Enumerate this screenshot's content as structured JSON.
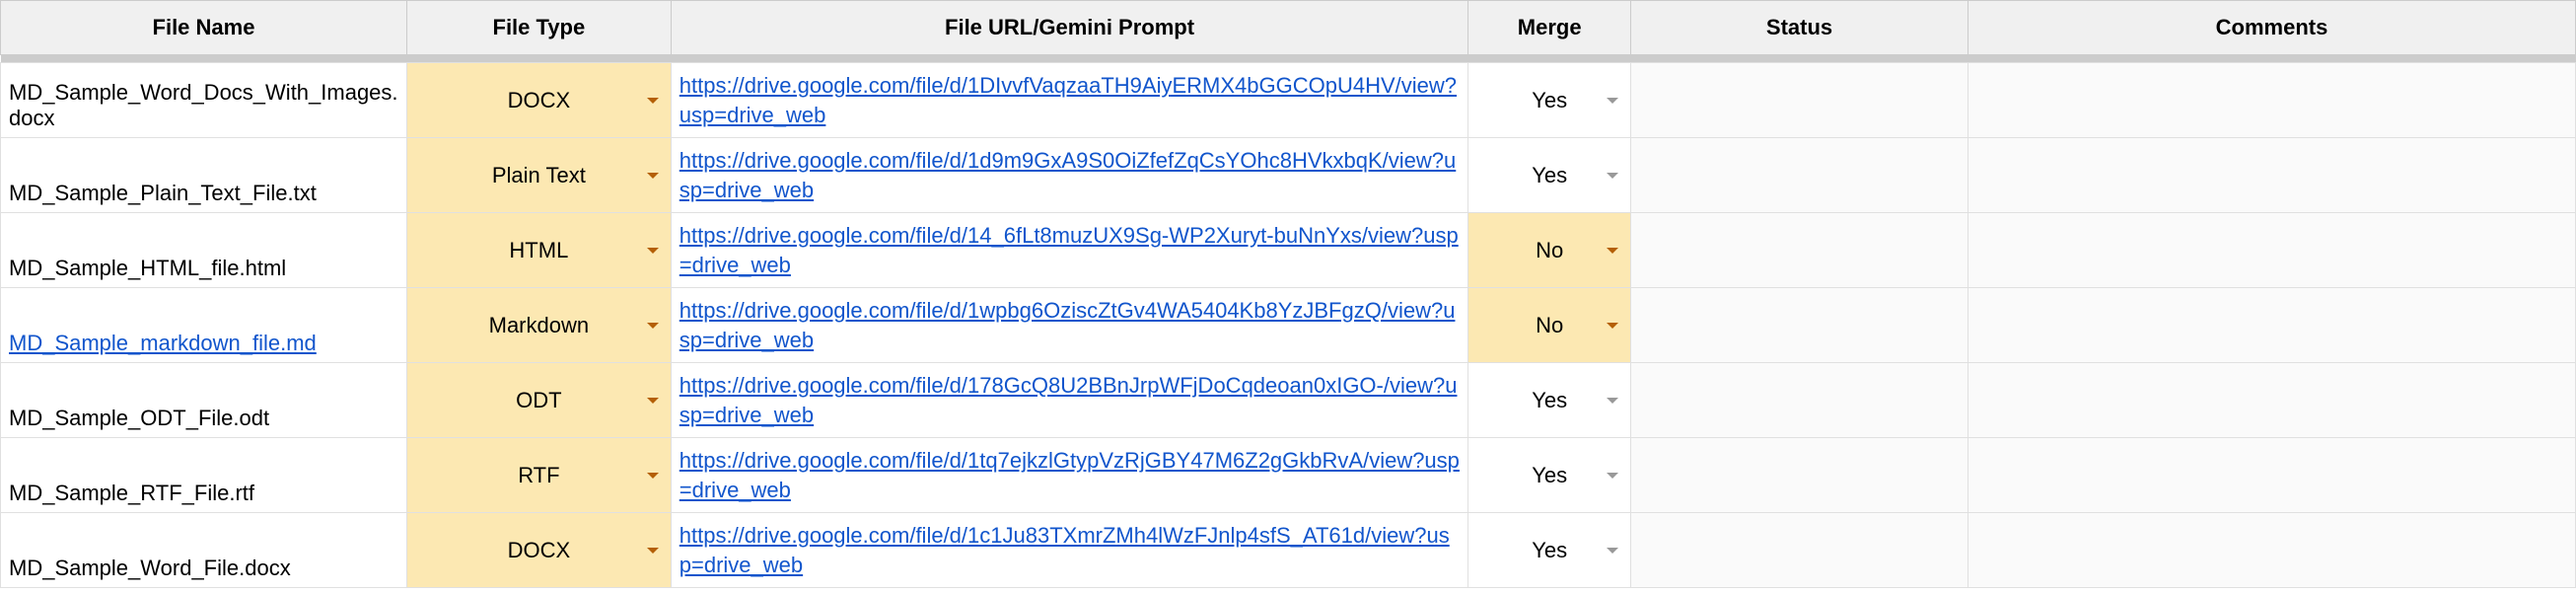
{
  "headers": {
    "filename": "File Name",
    "filetype": "File Type",
    "url": "File URL/Gemini Prompt",
    "merge": "Merge",
    "status": "Status",
    "comments": "Comments"
  },
  "rows": [
    {
      "filename": "MD_Sample_Word_Docs_With_Images.docx",
      "filename_is_link": false,
      "filetype": "DOCX",
      "url": "https://drive.google.com/file/d/1DIvvfVaqzaaTH9AiyERMX4bGGCOpU4HV/view?usp=drive_web",
      "merge": "Yes",
      "merge_highlight": false,
      "status": "",
      "comments": ""
    },
    {
      "filename": "MD_Sample_Plain_Text_File.txt",
      "filename_is_link": false,
      "filetype": "Plain Text",
      "url": "https://drive.google.com/file/d/1d9m9GxA9S0OiZfefZqCsYOhc8HVkxbqK/view?usp=drive_web",
      "merge": "Yes",
      "merge_highlight": false,
      "status": "",
      "comments": ""
    },
    {
      "filename": "MD_Sample_HTML_file.html",
      "filename_is_link": false,
      "filetype": "HTML",
      "url": "https://drive.google.com/file/d/14_6fLt8muzUX9Sg-WP2Xuryt-buNnYxs/view?usp=drive_web",
      "merge": "No",
      "merge_highlight": true,
      "status": "",
      "comments": ""
    },
    {
      "filename": "MD_Sample_markdown_file.md",
      "filename_is_link": true,
      "filetype": "Markdown",
      "url": "https://drive.google.com/file/d/1wpbg6OziscZtGv4WA5404Kb8YzJBFgzQ/view?usp=drive_web",
      "merge": "No",
      "merge_highlight": true,
      "status": "",
      "comments": ""
    },
    {
      "filename": "MD_Sample_ODT_File.odt",
      "filename_is_link": false,
      "filetype": "ODT",
      "url": "https://drive.google.com/file/d/178GcQ8U2BBnJrpWFjDoCqdeoan0xIGO-/view?usp=drive_web",
      "merge": "Yes",
      "merge_highlight": false,
      "status": "",
      "comments": ""
    },
    {
      "filename": "MD_Sample_RTF_File.rtf",
      "filename_is_link": false,
      "filetype": "RTF",
      "url": "https://drive.google.com/file/d/1tq7ejkzlGtypVzRjGBY47M6Z2gGkbRvA/view?usp=drive_web",
      "merge": "Yes",
      "merge_highlight": false,
      "status": "",
      "comments": ""
    },
    {
      "filename": "MD_Sample_Word_File.docx",
      "filename_is_link": false,
      "filetype": "DOCX",
      "url": "https://drive.google.com/file/d/1c1Ju83TXmrZMh4lWzFJnlp4sfS_AT61d/view?usp=drive_web",
      "merge": "Yes",
      "merge_highlight": false,
      "status": "",
      "comments": ""
    }
  ]
}
